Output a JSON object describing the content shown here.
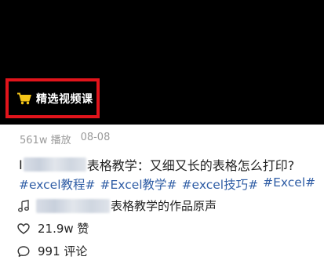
{
  "promo": {
    "label": "精选视频课",
    "icon": "shopping-cart-icon"
  },
  "meta": {
    "plays": "561w 播放",
    "date": "08-08"
  },
  "title": {
    "prefix": "I",
    "suffix": "表格教学：又细又长的表格怎么打印?"
  },
  "tags": [
    "#excel教程#",
    "#Excel教学#",
    "#excel技巧#",
    "#Excel#"
  ],
  "music": {
    "icon": "music-note-icon",
    "suffix": "表格教学的作品原声"
  },
  "likes": {
    "icon": "heart-icon",
    "text": "21.9w 赞"
  },
  "comments": {
    "icon": "comment-bubble-icon",
    "text": "991 评论"
  },
  "colors": {
    "promo_border": "#e1141b",
    "cart": "#f5c518",
    "hashtag": "#2f5da5",
    "meta": "#9a9a9a"
  }
}
